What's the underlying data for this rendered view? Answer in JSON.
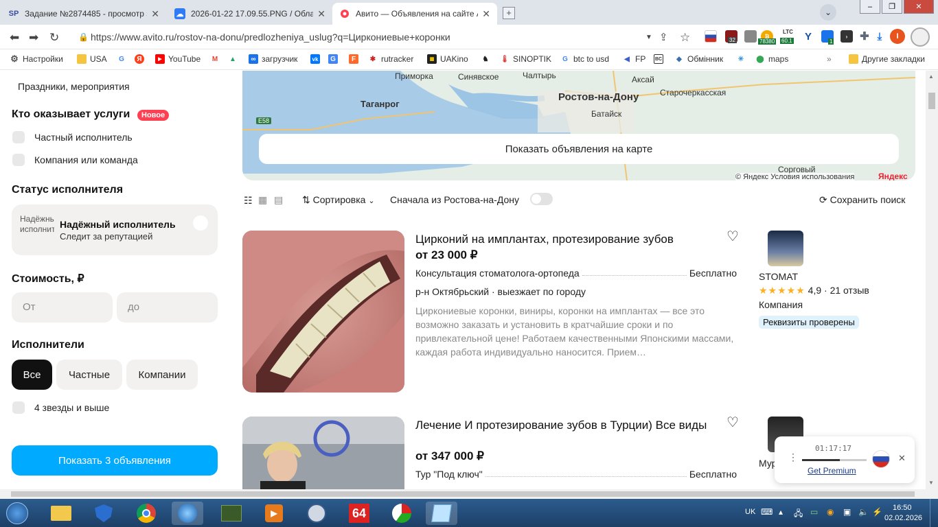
{
  "browser": {
    "tabs": [
      {
        "icon": "SP",
        "title": "Задание №2874485 - просмотр за",
        "active": false
      },
      {
        "icon": "cloud",
        "title": "2026-01-22 17.09.55.PNG / Облак",
        "active": false
      },
      {
        "icon": "avito",
        "title": "Авито — Объявления на сайте Ави",
        "active": true
      }
    ],
    "url": "https://www.avito.ru/rostov-na-donu/predlozheniya_uslug?q=Циркониевые+коронки",
    "extensions": {
      "badge1": "32",
      "ltc_label": "LTC",
      "badge_price": "78380",
      "badge_ltc": "60.1",
      "badge_green": "1",
      "profile_letter": "I"
    },
    "bookmarks": [
      "Настройки",
      "USA",
      "",
      "",
      "YouTube",
      "",
      "",
      "загрузчик",
      "",
      "",
      "",
      "rutracker",
      "UAKino",
      "",
      "SINOPTIK",
      "btc to usd",
      "FP",
      "",
      "Обмінник",
      "",
      "maps"
    ],
    "bookmarks_other": "Другие закладки"
  },
  "sidebar": {
    "category_partial": "Праздники, мероприятия",
    "provider_title": "Кто оказывает услуги",
    "badge_new": "Новое",
    "provider_options": [
      "Частный исполнитель",
      "Компания или команда"
    ],
    "status_title": "Статус исполнителя",
    "reliable_img_alt": "Надёжный исполнитель",
    "reliable_title": "Надёжный исполнитель",
    "reliable_sub": "Следит за репутацией",
    "cost_title": "Стоимость, ₽",
    "cost_from": "От",
    "cost_to": "до",
    "performers_title": "Исполнители",
    "performer_pills": [
      "Все",
      "Частные",
      "Компании"
    ],
    "stars_option": "4 звезды и выше",
    "cta_button": "Показать 3 объявления"
  },
  "map": {
    "labels": [
      "Приморка",
      "Синявское",
      "Чалтырь",
      "Аксай",
      "Таганрог",
      "Ростов-на-Дону",
      "Старочеркасская",
      "E58",
      "Батайск",
      "Сорговый"
    ],
    "show_on_map": "Показать объявления на карте",
    "copyright": "© Яндекс Условия использования",
    "yandex": "Яндекс"
  },
  "toolbar": {
    "sort_label": "Сортировка",
    "rostov_first": "Сначала из Ростова-на-Дону",
    "save_search": "Сохранить поиск"
  },
  "listings": [
    {
      "title": "Цирконий на имплантах, протезирование зубов",
      "price": "от 23 000 ₽",
      "service": "Консультация стоматолога-ортопеда",
      "service_price": "Бесплатно",
      "location": "р-н Октябрьский · выезжает по городу",
      "description": "Циркониевые коронки, виниры, коронки на имплантах — все это возможно заказать и установить в кратчайшие сроки и по привлекательной цене! Работаем качественными Японскими массами, каждая работа индивидуально наносится. Прием…",
      "seller": "STOMAT",
      "rating": "4,9",
      "reviews": "21 отзыв",
      "seller_type": "Компания",
      "verified": "Реквизиты проверены",
      "stars": 5
    },
    {
      "title": "Лечение И протезирование зубов в Турции) Все виды",
      "price": "от 347 000 ₽",
      "service": "Тур \"Под ключ\"",
      "service_price": "Бесплатно",
      "seller_partial": "Мур"
    }
  ],
  "widget": {
    "timer": "01:17:17",
    "premium": "Get Premium"
  },
  "taskbar": {
    "lang": "UK",
    "time": "16:50",
    "date": "02.02.2026",
    "app_64": "64"
  }
}
